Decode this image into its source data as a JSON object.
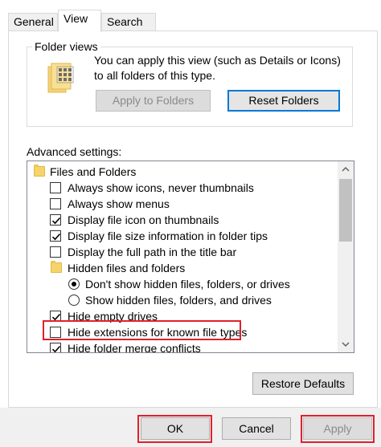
{
  "tabs": [
    {
      "label": "General",
      "active": false
    },
    {
      "label": "View",
      "active": true
    },
    {
      "label": "Search",
      "active": false
    }
  ],
  "folder_views": {
    "title": "Folder views",
    "description": "You can apply this view (such as Details or Icons) to all folders of this type.",
    "apply_button": "Apply to Folders",
    "reset_button": "Reset Folders"
  },
  "advanced": {
    "label": "Advanced settings:",
    "items": [
      {
        "kind": "folder",
        "label": "Files and Folders"
      },
      {
        "kind": "checkbox",
        "label": "Always show icons, never thumbnails",
        "checked": false
      },
      {
        "kind": "checkbox",
        "label": "Always show menus",
        "checked": false
      },
      {
        "kind": "checkbox",
        "label": "Display file icon on thumbnails",
        "checked": true
      },
      {
        "kind": "checkbox",
        "label": "Display file size information in folder tips",
        "checked": true
      },
      {
        "kind": "checkbox",
        "label": "Display the full path in the title bar",
        "checked": false
      },
      {
        "kind": "folder",
        "label": "Hidden files and folders"
      },
      {
        "kind": "radio",
        "label": "Don't show hidden files, folders, or drives",
        "checked": true
      },
      {
        "kind": "radio",
        "label": "Show hidden files, folders, and drives",
        "checked": false
      },
      {
        "kind": "checkbox",
        "label": "Hide empty drives",
        "checked": true
      },
      {
        "kind": "checkbox",
        "label": "Hide extensions for known file types",
        "checked": false
      },
      {
        "kind": "checkbox",
        "label": "Hide folder merge conflicts",
        "checked": true
      }
    ]
  },
  "restore_defaults": "Restore Defaults",
  "dialog_buttons": {
    "ok": "OK",
    "cancel": "Cancel",
    "apply": "Apply"
  },
  "colors": {
    "highlight": "#e0212b",
    "focus": "#0078d7"
  }
}
